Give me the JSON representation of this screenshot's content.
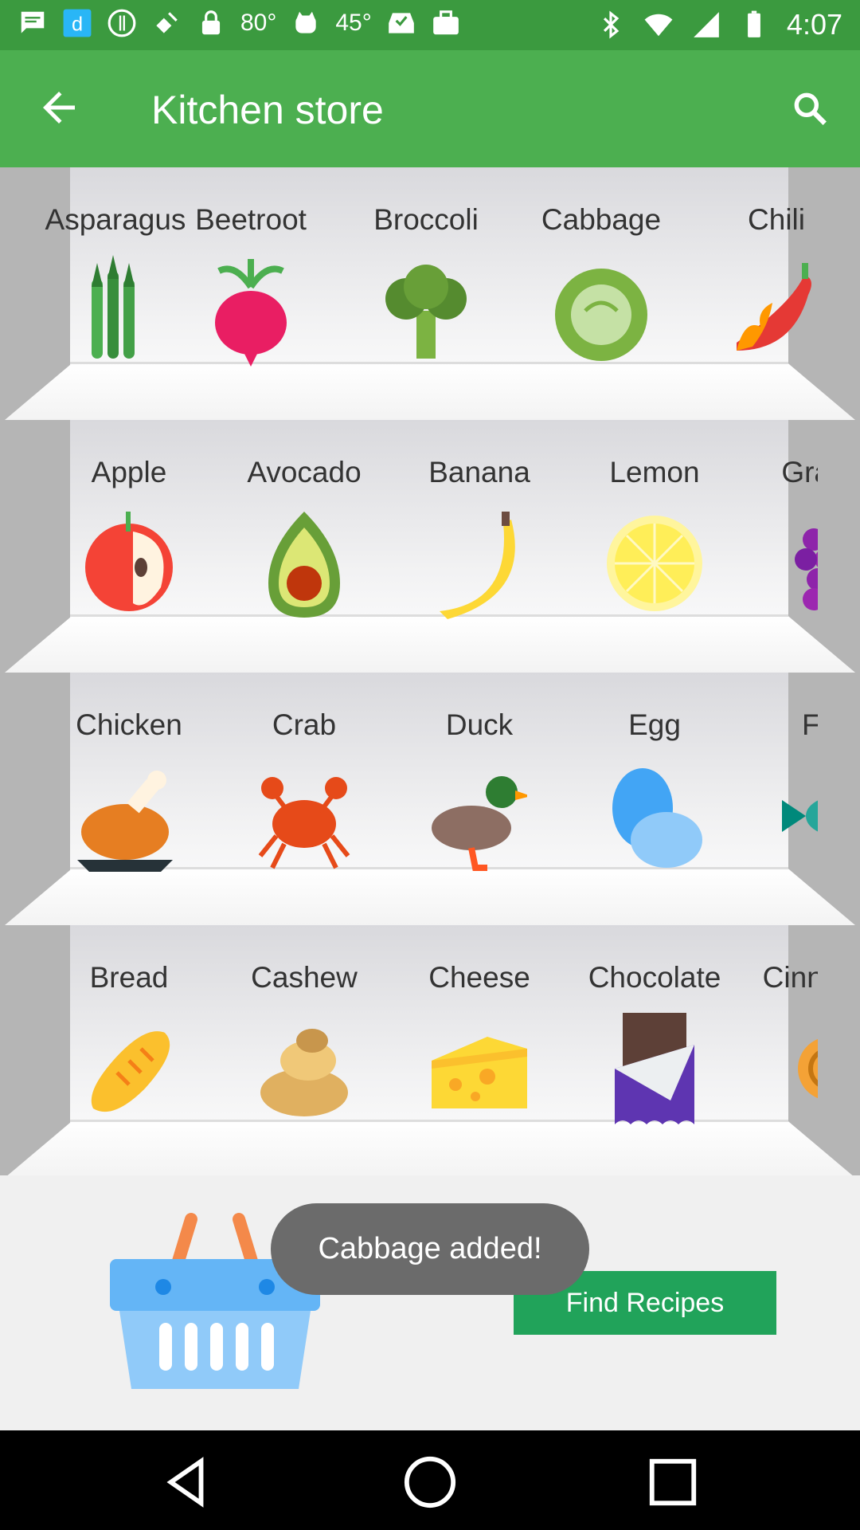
{
  "status_bar": {
    "temp1": "80°",
    "temp2": "45°",
    "time": "4:07"
  },
  "app_bar": {
    "title": "Kitchen store",
    "back_icon": "arrow-back-icon",
    "search_icon": "search-icon"
  },
  "shelves": [
    {
      "items": [
        "Asparagus",
        "Beetroot",
        "Broccoli",
        "Cabbage",
        "Chili"
      ]
    },
    {
      "items": [
        "Apple",
        "Avocado",
        "Banana",
        "Lemon",
        "Grapes"
      ]
    },
    {
      "items": [
        "Chicken",
        "Crab",
        "Duck",
        "Egg",
        "Fish"
      ]
    },
    {
      "items": [
        "Bread",
        "Cashew",
        "Cheese",
        "Chocolate",
        "Cinnamon"
      ]
    }
  ],
  "toast": "Cabbage added!",
  "find_recipes_label": "Find Recipes",
  "colors": {
    "status_bar": "#3b9a3f",
    "app_bar": "#4caf50",
    "button": "#21a35a",
    "toast": "#6b6b6b"
  }
}
